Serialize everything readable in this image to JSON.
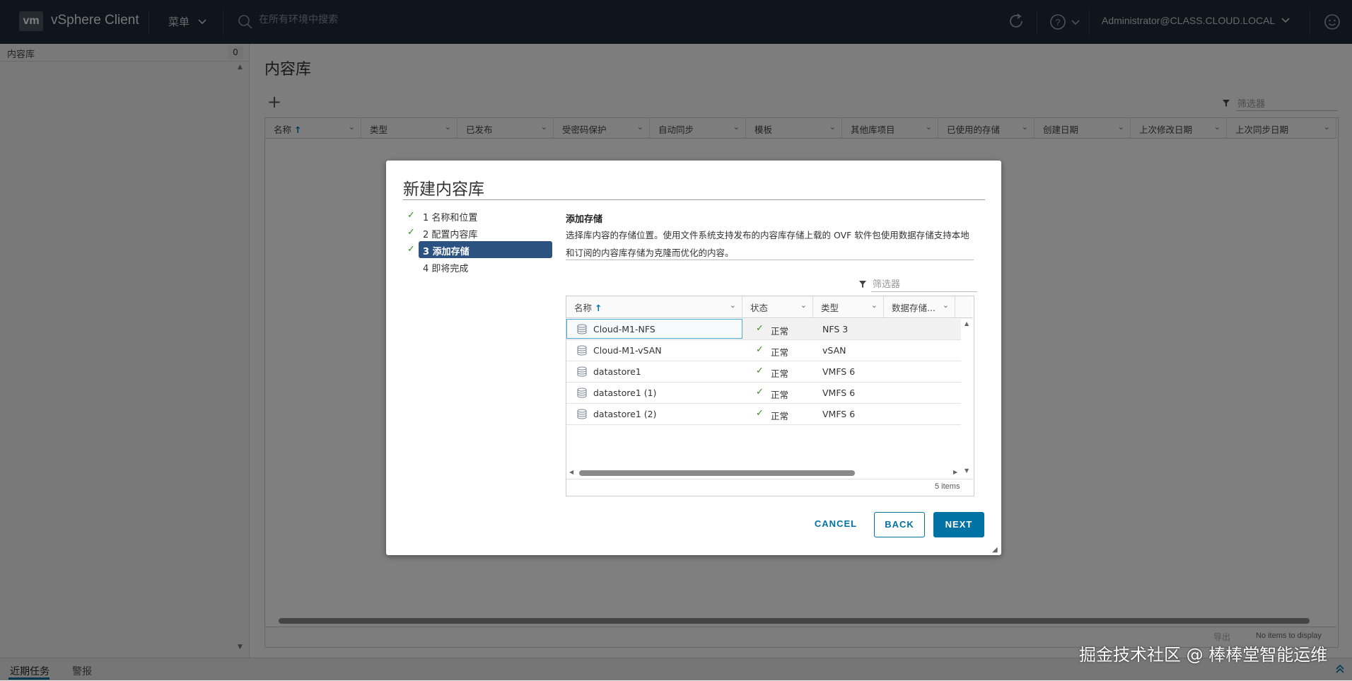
{
  "header": {
    "logo": "vm",
    "app_title": "vSphere Client",
    "menu_label": "菜单",
    "search_placeholder": "在所有环境中搜索",
    "user": "Administrator@CLASS.CLOUD.LOCAL"
  },
  "left_panel": {
    "title": "内容库",
    "count": "0"
  },
  "main": {
    "page_title": "内容库",
    "filter_placeholder": "筛选器",
    "columns": [
      "名称",
      "类型",
      "已发布",
      "受密码保护",
      "自动同步",
      "模板",
      "其他库项目",
      "已使用的存储",
      "创建日期",
      "上次修改日期",
      "上次同步日期"
    ],
    "export_label": "导出",
    "no_items": "No items to display"
  },
  "bottom": {
    "tab_recent": "近期任务",
    "tab_alarms": "警报"
  },
  "watermark": "掘金技术社区 @ 棒棒堂智能运维",
  "wizard": {
    "title": "新建内容库",
    "steps": [
      {
        "label": "1 名称和位置",
        "done": true
      },
      {
        "label": "2 配置内容库",
        "done": true
      },
      {
        "label": "3 添加存储",
        "done": true,
        "active": true
      },
      {
        "label": "4 即将完成",
        "done": false
      }
    ],
    "section_title": "添加存储",
    "description": "选择库内容的存储位置。使用文件系统支持发布的内容库存储上载的 OVF 软件包使用数据存储支持本地和订阅的内容库存储为克隆而优化的内容。",
    "filter_placeholder": "筛选器",
    "columns": [
      "名称",
      "状态",
      "类型",
      "数据存储..."
    ],
    "rows": [
      {
        "name": "Cloud-M1-NFS",
        "status": "正常",
        "type": "NFS 3"
      },
      {
        "name": "Cloud-M1-vSAN",
        "status": "正常",
        "type": "vSAN"
      },
      {
        "name": "datastore1",
        "status": "正常",
        "type": "VMFS 6"
      },
      {
        "name": "datastore1 (1)",
        "status": "正常",
        "type": "VMFS 6"
      },
      {
        "name": "datastore1 (2)",
        "status": "正常",
        "type": "VMFS 6"
      }
    ],
    "selected_row": 0,
    "item_count": "5 items",
    "buttons": {
      "cancel": "CANCEL",
      "back": "BACK",
      "next": "NEXT"
    }
  },
  "colors": {
    "header_bg": "#1f2a38",
    "accent": "#0072a3",
    "active_step": "#2b5280",
    "ok": "#3d8b1f"
  }
}
